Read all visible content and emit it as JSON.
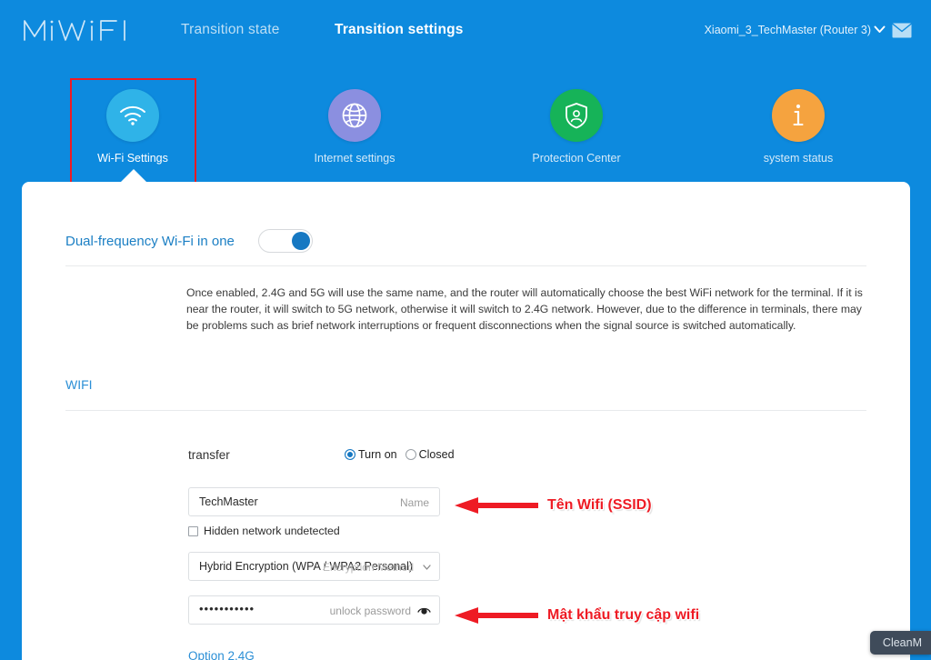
{
  "brand": {
    "logo_text": "MiWiFi"
  },
  "topnav": {
    "links": [
      {
        "label": "Transition state",
        "active": false
      },
      {
        "label": "Transition settings",
        "active": true
      }
    ],
    "router_name": "Xiaomi_3_TechMaster (Router 3)",
    "chevron_icon": "chevron-down-icon",
    "mail_icon": "mail-icon"
  },
  "iconnav": {
    "items": [
      {
        "label": "Wi-Fi Settings",
        "icon": "wifi-icon",
        "color": "#2fb3e8",
        "active": true
      },
      {
        "label": "Internet settings",
        "icon": "globe-icon",
        "color": "#8b8fe0",
        "active": false
      },
      {
        "label": "Protection Center",
        "icon": "shield-icon",
        "color": "#16b358",
        "active": false
      },
      {
        "label": "system status",
        "icon": "info-icon",
        "color": "#f5a33f",
        "active": false
      }
    ],
    "highlight_color": "#ee1b24"
  },
  "dual_band": {
    "label": "Dual-frequency Wi-Fi in one",
    "enabled": true,
    "description": "Once enabled, 2.4G and 5G will use the same name, and the router will automatically choose the best WiFi network for the terminal. If it is near the router, it will switch to 5G network, otherwise it will switch to 2.4G network. However, due to the difference in terminals, there may be problems such as brief network interruptions or frequent disconnections when the signal source is switched automatically."
  },
  "wifi_section": {
    "heading": "WIFI",
    "transfer": {
      "label": "transfer",
      "option_on": "Turn on",
      "option_off": "Closed",
      "selected": "Turn on"
    },
    "ssid": {
      "value": "TechMaster",
      "placeholder": "Name"
    },
    "hidden_network": {
      "label": "Hidden network undetected",
      "checked": false
    },
    "encryption": {
      "value": "Hybrid Encryption (WPA / WPA2 Personal)",
      "placeholder": "Encryption Method",
      "caret_icon": "chevron-down-icon"
    },
    "password": {
      "value": "•••••••••••",
      "placeholder": "unlock password",
      "eye_icon": "eye-icon"
    },
    "option_link": "Option 2.4G"
  },
  "annotations": {
    "color": "#ee1b24",
    "items": [
      {
        "text": "Tên Wifi (SSID)",
        "icon": "arrow-left-icon"
      },
      {
        "text": "Mật khẩu truy cập wifi",
        "icon": "arrow-left-icon"
      }
    ]
  },
  "overlay": {
    "cleanmymac_label": "CleanM"
  }
}
